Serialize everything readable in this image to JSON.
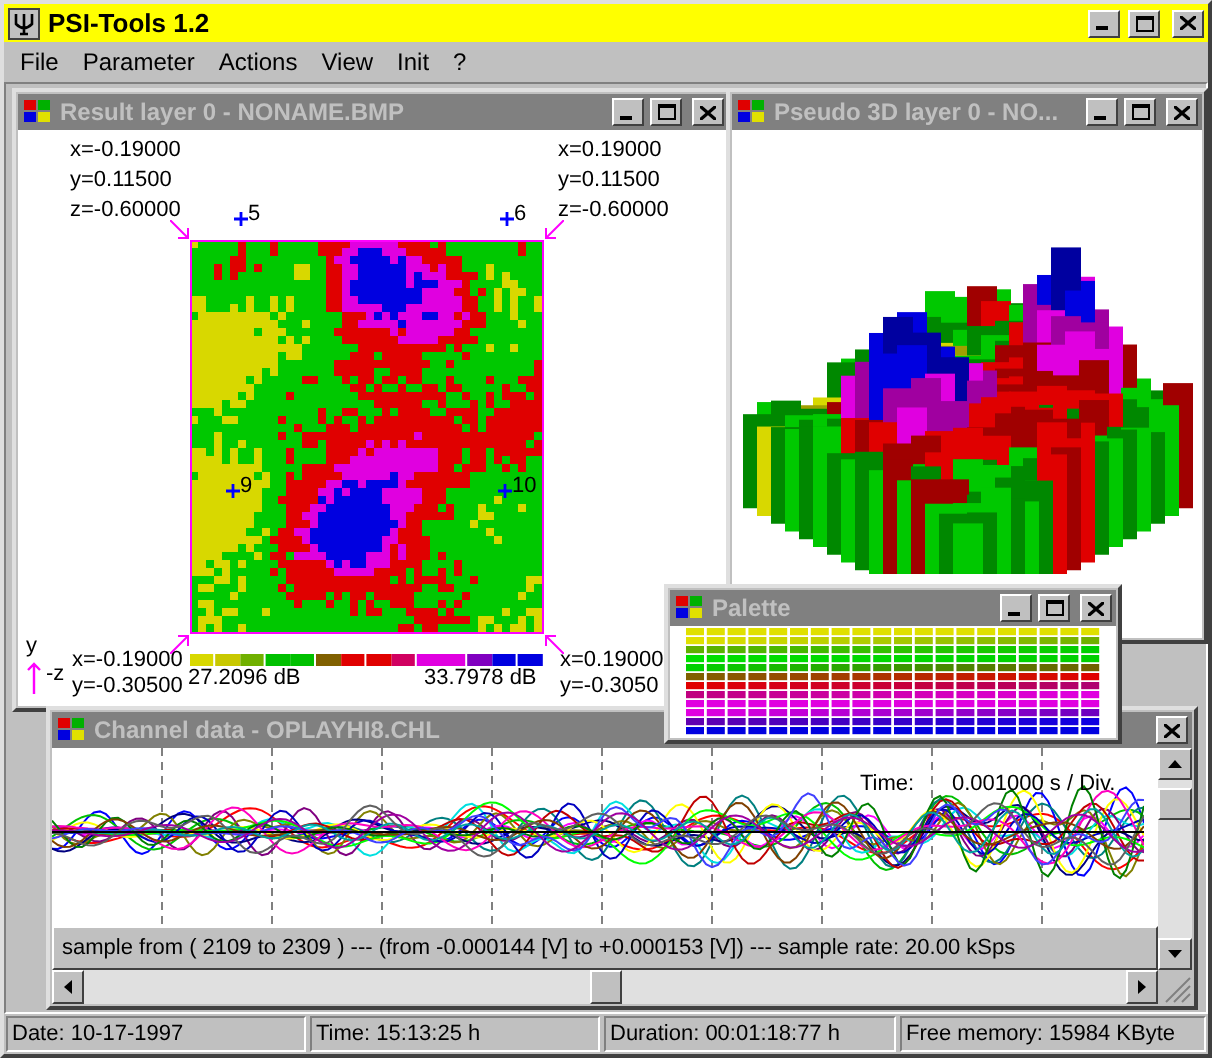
{
  "app": {
    "title": "PSI-Tools 1.2"
  },
  "menu": [
    {
      "label": "File"
    },
    {
      "label": "Parameter"
    },
    {
      "label": "Actions"
    },
    {
      "label": "View"
    },
    {
      "label": "Init"
    },
    {
      "label": "?"
    }
  ],
  "result_window": {
    "title": "Result layer 0 - NONAME.BMP",
    "top_left": [
      "x=-0.19000",
      "y=0.11500",
      "z=-0.60000"
    ],
    "top_right": [
      "x=0.19000",
      "y=0.11500",
      "z=-0.60000"
    ],
    "bottom_left": [
      "x=-0.19000",
      "y=-0.30500"
    ],
    "bottom_right": [
      "x=0.19000",
      "y=-0.3050"
    ],
    "markers": [
      {
        "label": "5"
      },
      {
        "label": "6"
      },
      {
        "label": "9"
      },
      {
        "label": "10"
      }
    ],
    "axis_labels": [
      "y",
      "-z"
    ],
    "scale": {
      "min": "27.2096 dB",
      "max": "33.7978 dB"
    }
  },
  "pseudo3d_window": {
    "title": "Pseudo 3D layer 0 - NO..."
  },
  "palette_window": {
    "title": "Palette"
  },
  "channel_window": {
    "title": "Channel data - OPLAYHI8.CHL",
    "time_label": "Time:",
    "time_value": "0.001000 s / Div.",
    "info": "sample from ( 2109 to 2309 ) --- (from -0.000144 [V] to +0.000153 [V]) --- sample rate: 20.00 kSps"
  },
  "status_bar": [
    "Date: 10-17-1997",
    "Time: 15:13:25 h",
    "Duration: 00:01:18:77 h",
    "Free memory: 15984 KByte"
  ]
}
